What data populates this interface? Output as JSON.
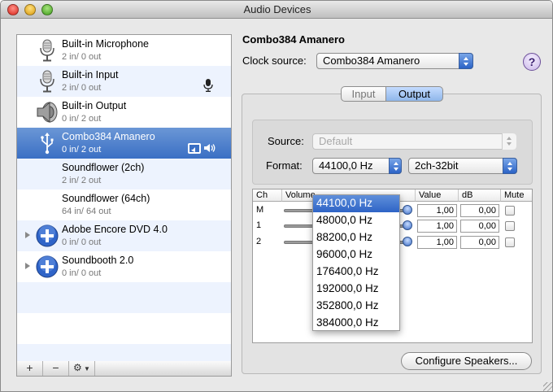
{
  "window": {
    "title": "Audio Devices"
  },
  "devices": [
    {
      "name": "Built-in Microphone",
      "io": "2 in/ 0 out",
      "icon": "microphone-icon"
    },
    {
      "name": "Built-in Input",
      "io": "2 in/ 0 out",
      "icon": "microphone-icon",
      "badge": "default-input-icon"
    },
    {
      "name": "Built-in Output",
      "io": "0 in/ 2 out",
      "icon": "speaker-icon"
    },
    {
      "name": "Combo384 Amanero",
      "io": "0 in/ 2 out",
      "icon": "usb-icon",
      "badge": "default-output-and-system-icons",
      "selected": true
    },
    {
      "name": "Soundflower (2ch)",
      "io": "2 in/ 2 out",
      "icon": ""
    },
    {
      "name": "Soundflower (64ch)",
      "io": "64 in/ 64 out",
      "icon": ""
    },
    {
      "name": "Adobe Encore DVD 4.0",
      "io": "0 in/ 0 out",
      "icon": "aggregate-plus-icon",
      "disclosure": true
    },
    {
      "name": "Soundbooth 2.0",
      "io": "0 in/ 0 out",
      "icon": "aggregate-plus-icon",
      "disclosure": true
    }
  ],
  "list_buttons": {
    "add": "+",
    "remove": "−",
    "gear": "⚙"
  },
  "device_title": "Combo384 Amanero",
  "clock": {
    "label": "Clock source:",
    "value": "Combo384 Amanero"
  },
  "help_label": "?",
  "tabs": {
    "input": "Input",
    "output": "Output",
    "selected": "Output"
  },
  "source": {
    "label": "Source:",
    "value": "Default"
  },
  "format": {
    "label": "Format:",
    "rate": "44100,0 Hz",
    "bits": "2ch-32bit"
  },
  "table": {
    "headers": [
      "Ch",
      "Volume",
      "Value",
      "dB",
      "Mute"
    ],
    "rows": [
      {
        "ch": "M",
        "value": "1,00",
        "db": "0,00"
      },
      {
        "ch": "1",
        "value": "1,00",
        "db": "0,00"
      },
      {
        "ch": "2",
        "value": "1,00",
        "db": "0,00"
      }
    ]
  },
  "rate_menu": {
    "options": [
      "44100,0 Hz",
      "48000,0 Hz",
      "88200,0 Hz",
      "96000,0 Hz",
      "176400,0 Hz",
      "192000,0 Hz",
      "352800,0 Hz",
      "384000,0 Hz"
    ],
    "highlighted": "44100,0 Hz"
  },
  "configure_button": "Configure Speakers...",
  "colors": {
    "selection": "#3a6fc4",
    "alt_row": "#edf3fe",
    "accent": "#2b63c6"
  }
}
